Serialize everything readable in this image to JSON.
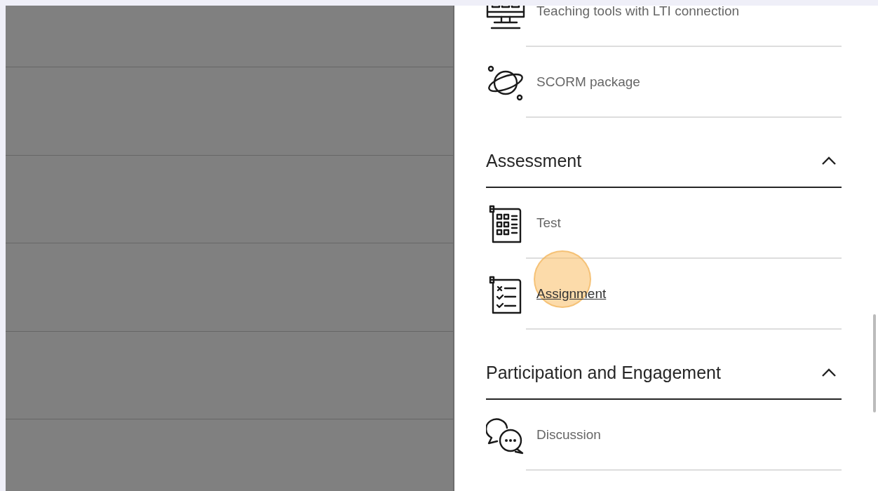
{
  "panel": {
    "groups": [
      {
        "items": [
          {
            "kind": "lti",
            "label": "Teaching tools with LTI connection",
            "hovered": false
          },
          {
            "kind": "scorm",
            "label": "SCORM package",
            "hovered": false
          }
        ]
      },
      {
        "title": "Assessment",
        "expanded": true,
        "items": [
          {
            "kind": "test",
            "label": "Test",
            "hovered": false
          },
          {
            "kind": "assignment",
            "label": "Assignment",
            "hovered": true
          }
        ]
      },
      {
        "title": "Participation and Engagement",
        "expanded": true,
        "items": [
          {
            "kind": "discussion",
            "label": "Discussion",
            "hovered": false
          }
        ]
      }
    ]
  }
}
